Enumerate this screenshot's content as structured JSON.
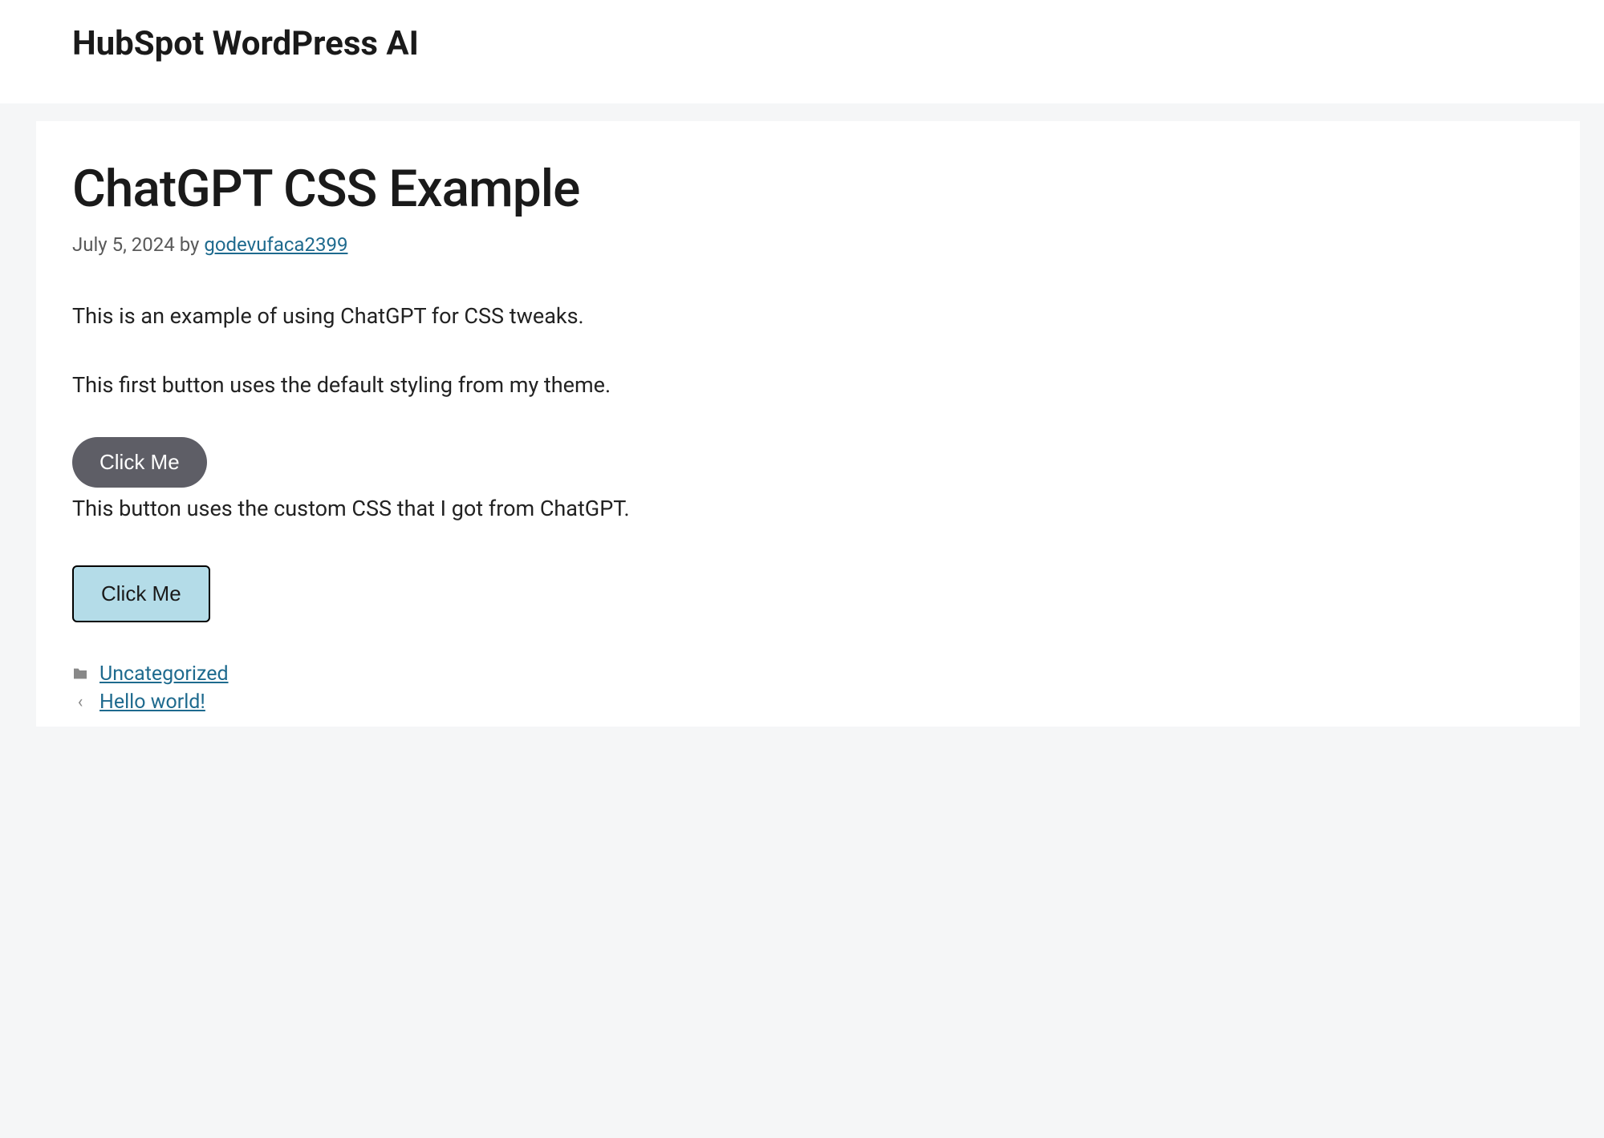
{
  "header": {
    "site_title": "HubSpot WordPress AI"
  },
  "post": {
    "title": "ChatGPT CSS Example",
    "date": "July 5, 2024",
    "by_label": "by",
    "author": "godevufaca2399",
    "paragraph1": "This is an example of using ChatGPT for CSS tweaks.",
    "paragraph2": "This first button uses the default styling from my theme.",
    "button_default_label": "Click Me",
    "paragraph3": "This button uses the custom CSS that I got from ChatGPT.",
    "button_custom_label": "Click Me"
  },
  "footer": {
    "category": "Uncategorized",
    "prev_post": "Hello world!"
  },
  "colors": {
    "link": "#1e6a8e",
    "button_default_bg": "#5e5e66",
    "button_custom_bg": "#b4dce8",
    "page_bg": "#f5f6f7"
  }
}
